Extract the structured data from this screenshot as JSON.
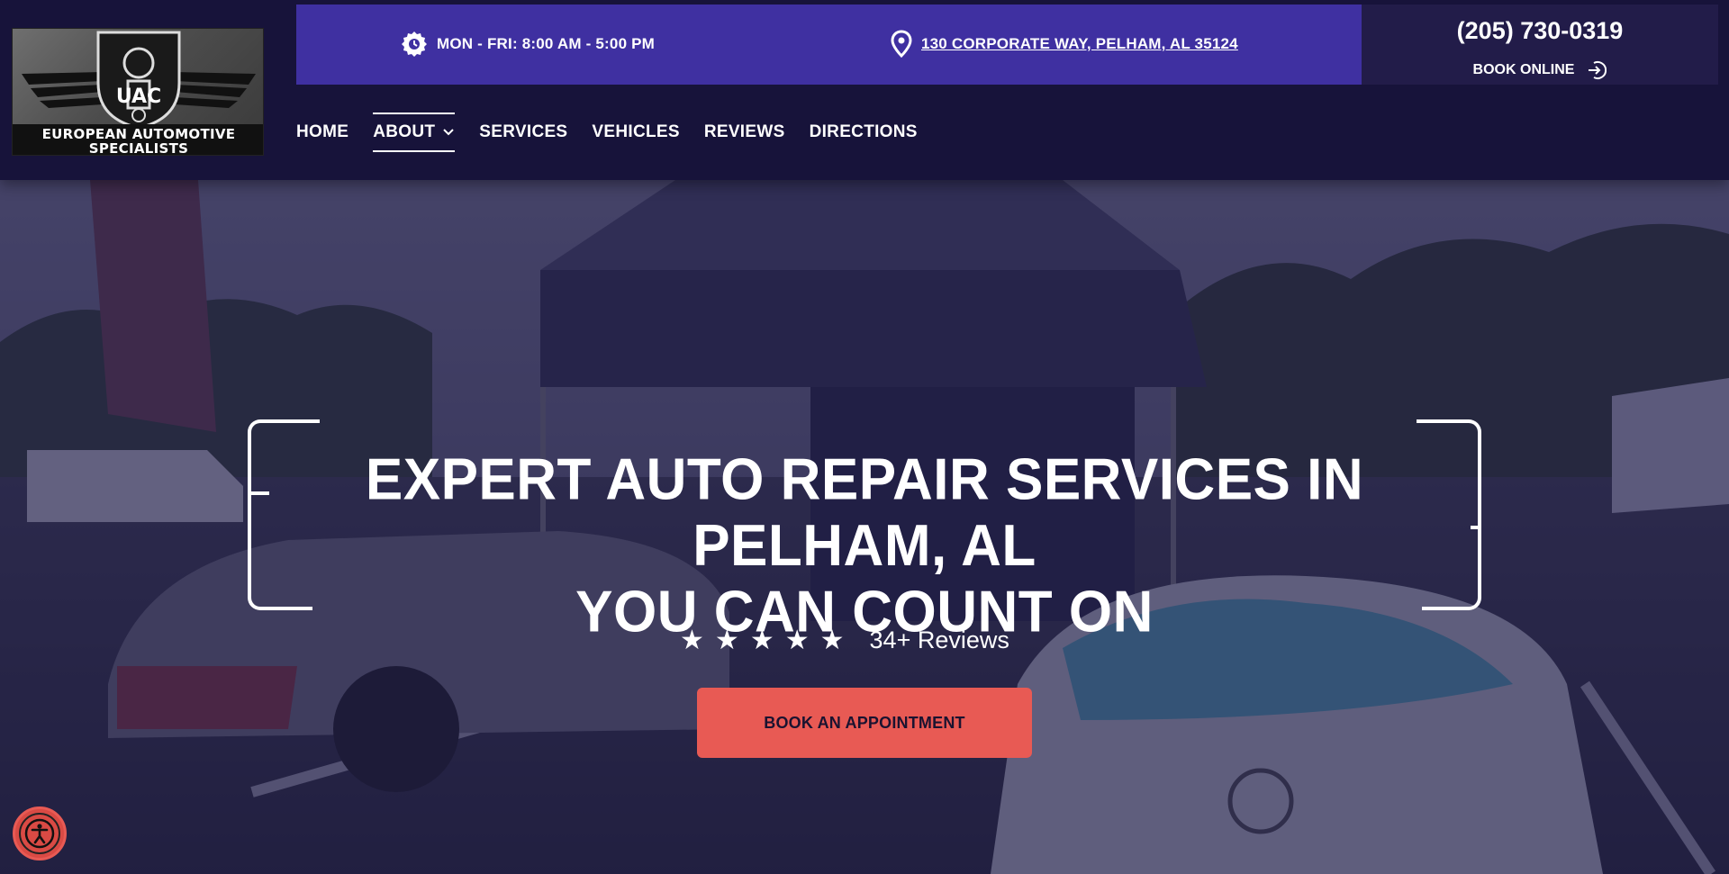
{
  "brand": {
    "logo_line1": "EUROPEAN AUTOMOTIVE",
    "logo_line2": "SPECIALISTS",
    "logo_monogram": "UAC"
  },
  "topbar": {
    "hours_icon": "clock-gear-icon",
    "hours": "MON - FRI: 8:00 AM - 5:00 PM",
    "address_icon": "map-pin-icon",
    "address": "130 CORPORATE WAY, PELHAM, AL 35124",
    "phone": "(205) 730-0319",
    "book_online": "BOOK ONLINE",
    "book_online_icon": "login-arrow-icon"
  },
  "nav": {
    "items": [
      {
        "label": "HOME"
      },
      {
        "label": "ABOUT",
        "dropdown": true,
        "active": true
      },
      {
        "label": "SERVICES"
      },
      {
        "label": "VEHICLES"
      },
      {
        "label": "REVIEWS"
      },
      {
        "label": "DIRECTIONS"
      }
    ]
  },
  "hero": {
    "headline_line1": "EXPERT AUTO REPAIR SERVICES IN PELHAM, AL",
    "headline_line2": "YOU CAN COUNT ON",
    "stars": 5,
    "reviews": "34+ Reviews",
    "cta": "BOOK AN APPOINTMENT"
  },
  "accessibility": {
    "icon": "accessibility-icon"
  },
  "colors": {
    "header_bg": "#17133a",
    "topbar_bg": "#3f30a1",
    "phone_box_bg": "#221c49",
    "cta_bg": "#e85a54",
    "overlay": "#1a1646"
  }
}
